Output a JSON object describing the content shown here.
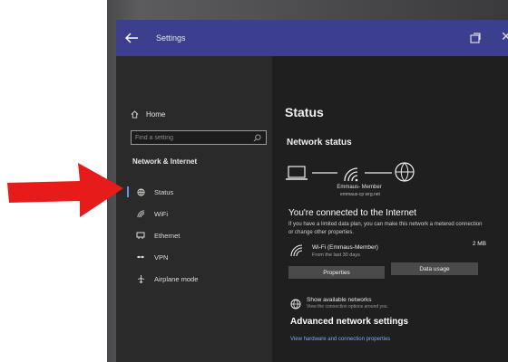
{
  "window": {
    "title": "Settings"
  },
  "sidebar": {
    "home_label": "Home",
    "search_placeholder": "Find a setting",
    "section_title": "Network & Internet",
    "items": [
      {
        "label": "Status",
        "icon": "globe-icon",
        "active": true
      },
      {
        "label": "WiFi",
        "icon": "wifi-icon"
      },
      {
        "label": "Ethernet",
        "icon": "ethernet-icon"
      },
      {
        "label": "VPN",
        "icon": "vpn-icon"
      },
      {
        "label": "Airplane mode",
        "icon": "airplane-icon"
      }
    ]
  },
  "content": {
    "page_title": "Status",
    "network_status_title": "Network status",
    "network_name": "Emmaus- Member",
    "network_sub": "emmaus-cp wrg.net",
    "connected_title": "You're connected to the Internet",
    "connected_desc": "If you have a limited data plan, you can make this network a metered connection or change other properties.",
    "wifi_name": "Wi-Fi (Emmaus-Member)",
    "wifi_since": "From the last 30 days",
    "wifi_usage": "2 MB",
    "properties_button": "Properties",
    "data_usage_button": "Data usage",
    "show_networks_title": "Show available networks",
    "show_networks_sub": "View the connection options around you.",
    "advanced_title": "Advanced network settings",
    "advanced_link": "View hardware and connection properties"
  },
  "colors": {
    "titlebar": "#3b3f8e",
    "arrow": "#e81b1b",
    "link": "#7fa6ff"
  }
}
